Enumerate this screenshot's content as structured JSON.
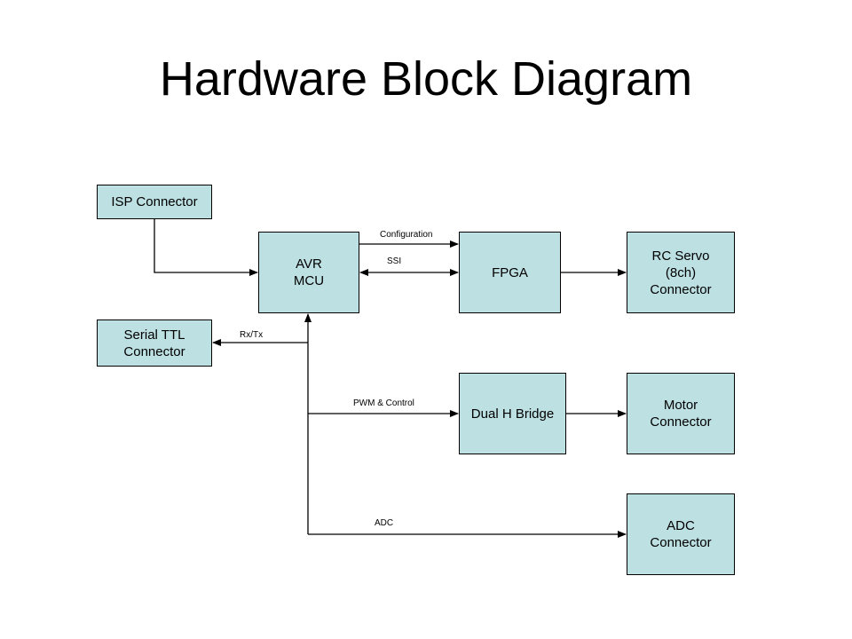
{
  "title": "Hardware Block Diagram",
  "blocks": {
    "isp": "ISP Connector",
    "avr": "AVR\nMCU",
    "serial": "Serial TTL\nConnector",
    "fpga": "FPGA",
    "rcservo": "RC Servo\n(8ch)\nConnector",
    "hbridge": "Dual H Bridge",
    "motor": "Motor\nConnector",
    "adc": "ADC\nConnector"
  },
  "links": {
    "configuration": "Configuration",
    "ssi": "SSI",
    "rxtx": "Rx/Tx",
    "pwm": "PWM & Control",
    "adc": "ADC"
  },
  "colors": {
    "block_fill": "#bde0e3",
    "line": "#000000"
  }
}
